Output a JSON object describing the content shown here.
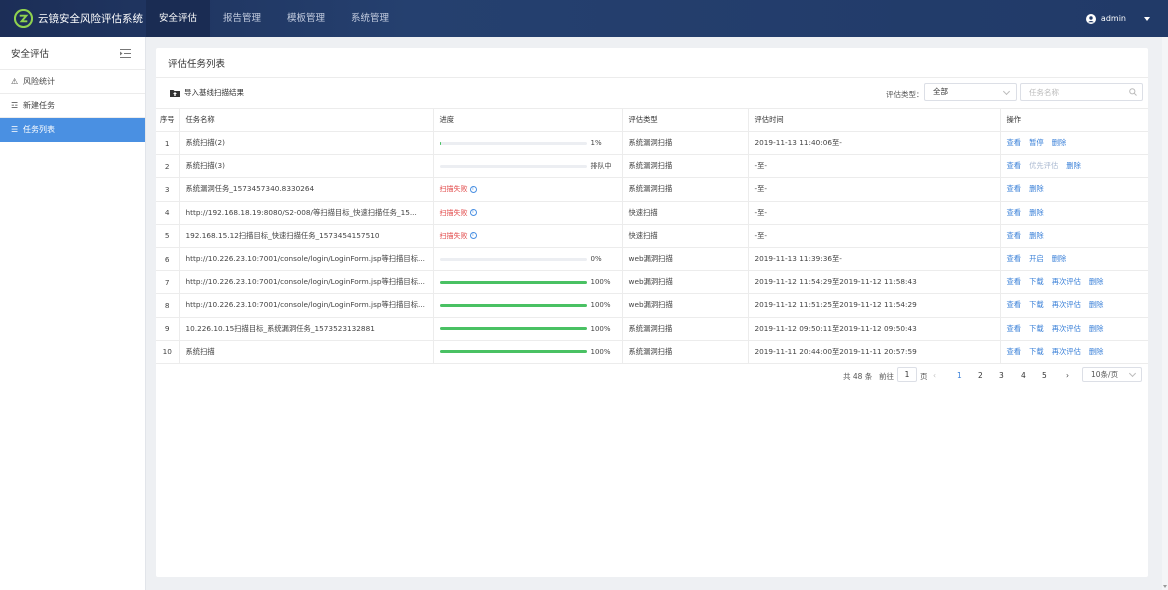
{
  "app": {
    "title": "云镜安全风险评估系统"
  },
  "nav": {
    "items": [
      "安全评估",
      "报告管理",
      "模板管理",
      "系统管理"
    ],
    "active": 0
  },
  "user": {
    "name": "admin"
  },
  "sidebar": {
    "title": "安全评估",
    "items": [
      {
        "label": "风险统计",
        "icon": "warning-icon"
      },
      {
        "label": "新建任务",
        "icon": "form-icon"
      },
      {
        "label": "任务列表",
        "icon": "list-icon"
      }
    ],
    "active": 2
  },
  "card": {
    "title": "评估任务列表"
  },
  "toolbar": {
    "import_label": "导入基线扫描结果",
    "filter_label": "评估类型：",
    "filter_value": "全部",
    "search_placeholder": "任务名称"
  },
  "table": {
    "columns": [
      "序号",
      "任务名称",
      "进度",
      "评估类型",
      "评估时间",
      "操作"
    ],
    "rows": [
      {
        "no": "1",
        "name": "系统扫描(2)",
        "progress": 1,
        "status": "1%",
        "type": "系统漏洞扫描",
        "time": "2019-11-13 11:40:06至-",
        "actions": [
          "查看",
          "暂停",
          "删除"
        ]
      },
      {
        "no": "2",
        "name": "系统扫描(3)",
        "progress": 0,
        "status": "排队中",
        "type": "系统漏洞扫描",
        "time": "-至-",
        "actions": [
          "查看",
          "优先评估",
          "删除"
        ]
      },
      {
        "no": "3",
        "name": "系统漏洞任务_1573457340.8330264",
        "failed": true,
        "status": "扫描失败",
        "type": "系统漏洞扫描",
        "time": "-至-",
        "actions": [
          "查看",
          "删除"
        ]
      },
      {
        "no": "4",
        "name": "http://192.168.18.19:8080/S2-008/等扫描目标_快速扫描任务_15...",
        "failed": true,
        "status": "扫描失败",
        "type": "快速扫描",
        "time": "-至-",
        "actions": [
          "查看",
          "删除"
        ]
      },
      {
        "no": "5",
        "name": "192.168.15.12扫描目标_快速扫描任务_1573454157510",
        "failed": true,
        "status": "扫描失败",
        "type": "快速扫描",
        "time": "-至-",
        "actions": [
          "查看",
          "删除"
        ]
      },
      {
        "no": "6",
        "name": "http://10.226.23.10:7001/console/login/LoginForm.jsp等扫描目标...",
        "progress": 0,
        "status": "0%",
        "type": "web漏洞扫描",
        "time": "2019-11-13 11:39:36至-",
        "actions": [
          "查看",
          "开启",
          "删除"
        ]
      },
      {
        "no": "7",
        "name": "http://10.226.23.10:7001/console/login/LoginForm.jsp等扫描目标...",
        "progress": 100,
        "status": "100%",
        "type": "web漏洞扫描",
        "time": "2019-11-12 11:54:29至2019-11-12 11:58:43",
        "actions": [
          "查看",
          "下载",
          "再次评估",
          "删除"
        ]
      },
      {
        "no": "8",
        "name": "http://10.226.23.10:7001/console/login/LoginForm.jsp等扫描目标...",
        "progress": 100,
        "status": "100%",
        "type": "web漏洞扫描",
        "time": "2019-11-12 11:51:25至2019-11-12 11:54:29",
        "actions": [
          "查看",
          "下载",
          "再次评估",
          "删除"
        ]
      },
      {
        "no": "9",
        "name": "10.226.10.15扫描目标_系统漏洞任务_1573523132881",
        "progress": 100,
        "status": "100%",
        "type": "系统漏洞扫描",
        "time": "2019-11-12 09:50:11至2019-11-12 09:50:43",
        "actions": [
          "查看",
          "下载",
          "再次评估",
          "删除"
        ]
      },
      {
        "no": "10",
        "name": "系统扫描",
        "progress": 100,
        "status": "100%",
        "type": "系统漏洞扫描",
        "time": "2019-11-11 20:44:00至2019-11-11 20:57:59",
        "actions": [
          "查看",
          "下载",
          "再次评估",
          "删除"
        ]
      }
    ]
  },
  "pagination": {
    "total": "共 48 条",
    "goto_prefix": "前往",
    "goto_value": "1",
    "goto_suffix": "页",
    "prev": "‹",
    "next": "›",
    "pages": [
      "1",
      "2",
      "3",
      "4",
      "5"
    ],
    "current": "1",
    "page_size": "10条/页"
  },
  "colors": {
    "accent": "#4a90e2",
    "success": "#49c163",
    "danger": "#e24a4a",
    "topbar": "#213a68"
  }
}
